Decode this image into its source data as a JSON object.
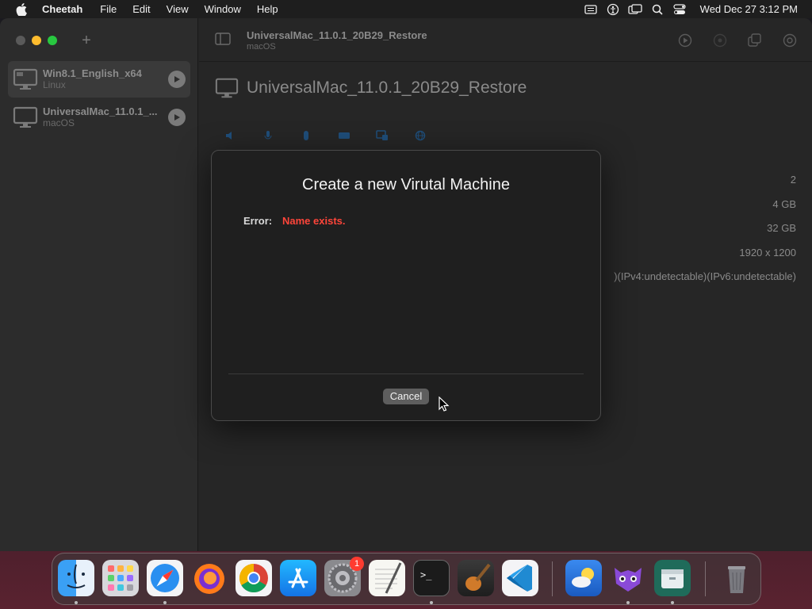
{
  "menubar": {
    "app_name": "Cheetah",
    "items": [
      "File",
      "Edit",
      "View",
      "Window",
      "Help"
    ],
    "clock": "Wed Dec 27  3:12 PM"
  },
  "sidebar": {
    "vms": [
      {
        "name": "Win8.1_English_x64",
        "os": "Linux"
      },
      {
        "name": "UniversalMac_11.0.1_...",
        "os": "macOS"
      }
    ]
  },
  "toolbar": {
    "title": "UniversalMac_11.0.1_20B29_Restore",
    "subtitle": "macOS"
  },
  "vm_detail": {
    "title": "UniversalMac_11.0.1_20B29_Restore",
    "specs": [
      "2",
      "4 GB",
      "32 GB",
      "1920 x 1200",
      ")(IPv4:undetectable)(IPv6:undetectable)"
    ]
  },
  "dialog": {
    "title": "Create a new Virutal Machine",
    "error_label": "Error:",
    "error_message": "Name exists.",
    "cancel_label": "Cancel"
  },
  "dock": {
    "apps": [
      "finder",
      "launchpad",
      "safari",
      "firefox",
      "chrome",
      "app-store",
      "system-preferences",
      "textedit",
      "terminal",
      "garageband",
      "vscode",
      "weather",
      "cheetah",
      "archive",
      "trash"
    ],
    "system_preferences_badge": "1"
  },
  "colors": {
    "error": "#ff453a",
    "accent": "#0a84ff"
  }
}
